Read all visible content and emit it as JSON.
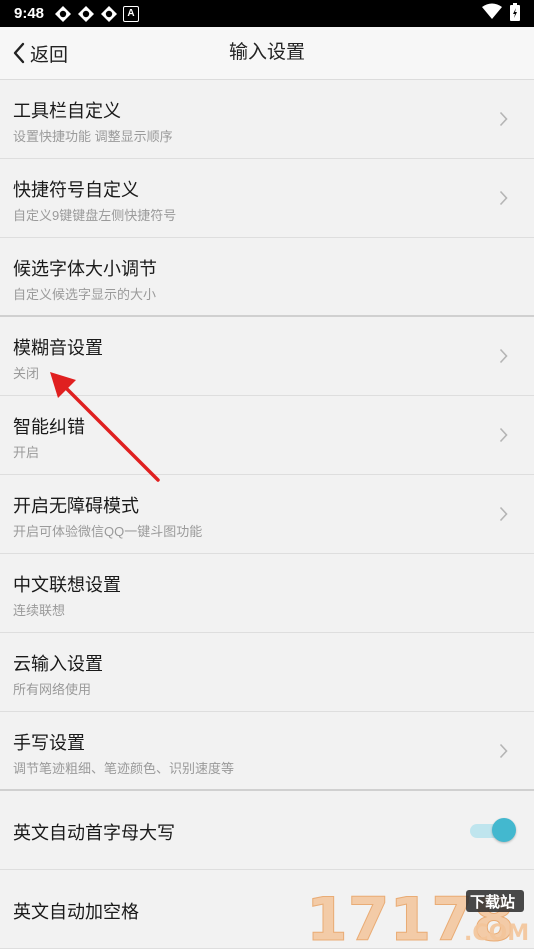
{
  "status": {
    "time": "9:48",
    "badge": "A"
  },
  "header": {
    "back_label": "返回",
    "title": "输入设置"
  },
  "items": [
    {
      "title": "工具栏自定义",
      "subtitle": "设置快捷功能 调整显示顺序"
    },
    {
      "title": "快捷符号自定义",
      "subtitle": "自定义9键键盘左侧快捷符号"
    },
    {
      "title": "候选字体大小调节",
      "subtitle": "自定义候选字显示的大小"
    },
    {
      "title": "模糊音设置",
      "subtitle": "关闭"
    },
    {
      "title": "智能纠错",
      "subtitle": "开启"
    },
    {
      "title": "开启无障碍模式",
      "subtitle": "开启可体验微信QQ一键斗图功能"
    },
    {
      "title": "中文联想设置",
      "subtitle": "连续联想"
    },
    {
      "title": "云输入设置",
      "subtitle": "所有网络使用"
    },
    {
      "title": "手写设置",
      "subtitle": "调节笔迹粗细、笔迹颜色、识别速度等"
    },
    {
      "title": "英文自动首字母大写"
    },
    {
      "title": "英文自动加空格"
    }
  ],
  "toggle_states": {
    "english_capitalize": true
  },
  "colors": {
    "accent": "#43b8cf",
    "annotation_arrow": "#e02020"
  },
  "watermark": {
    "number": "17178",
    "tag": "下载站",
    "domain": ".COM"
  }
}
